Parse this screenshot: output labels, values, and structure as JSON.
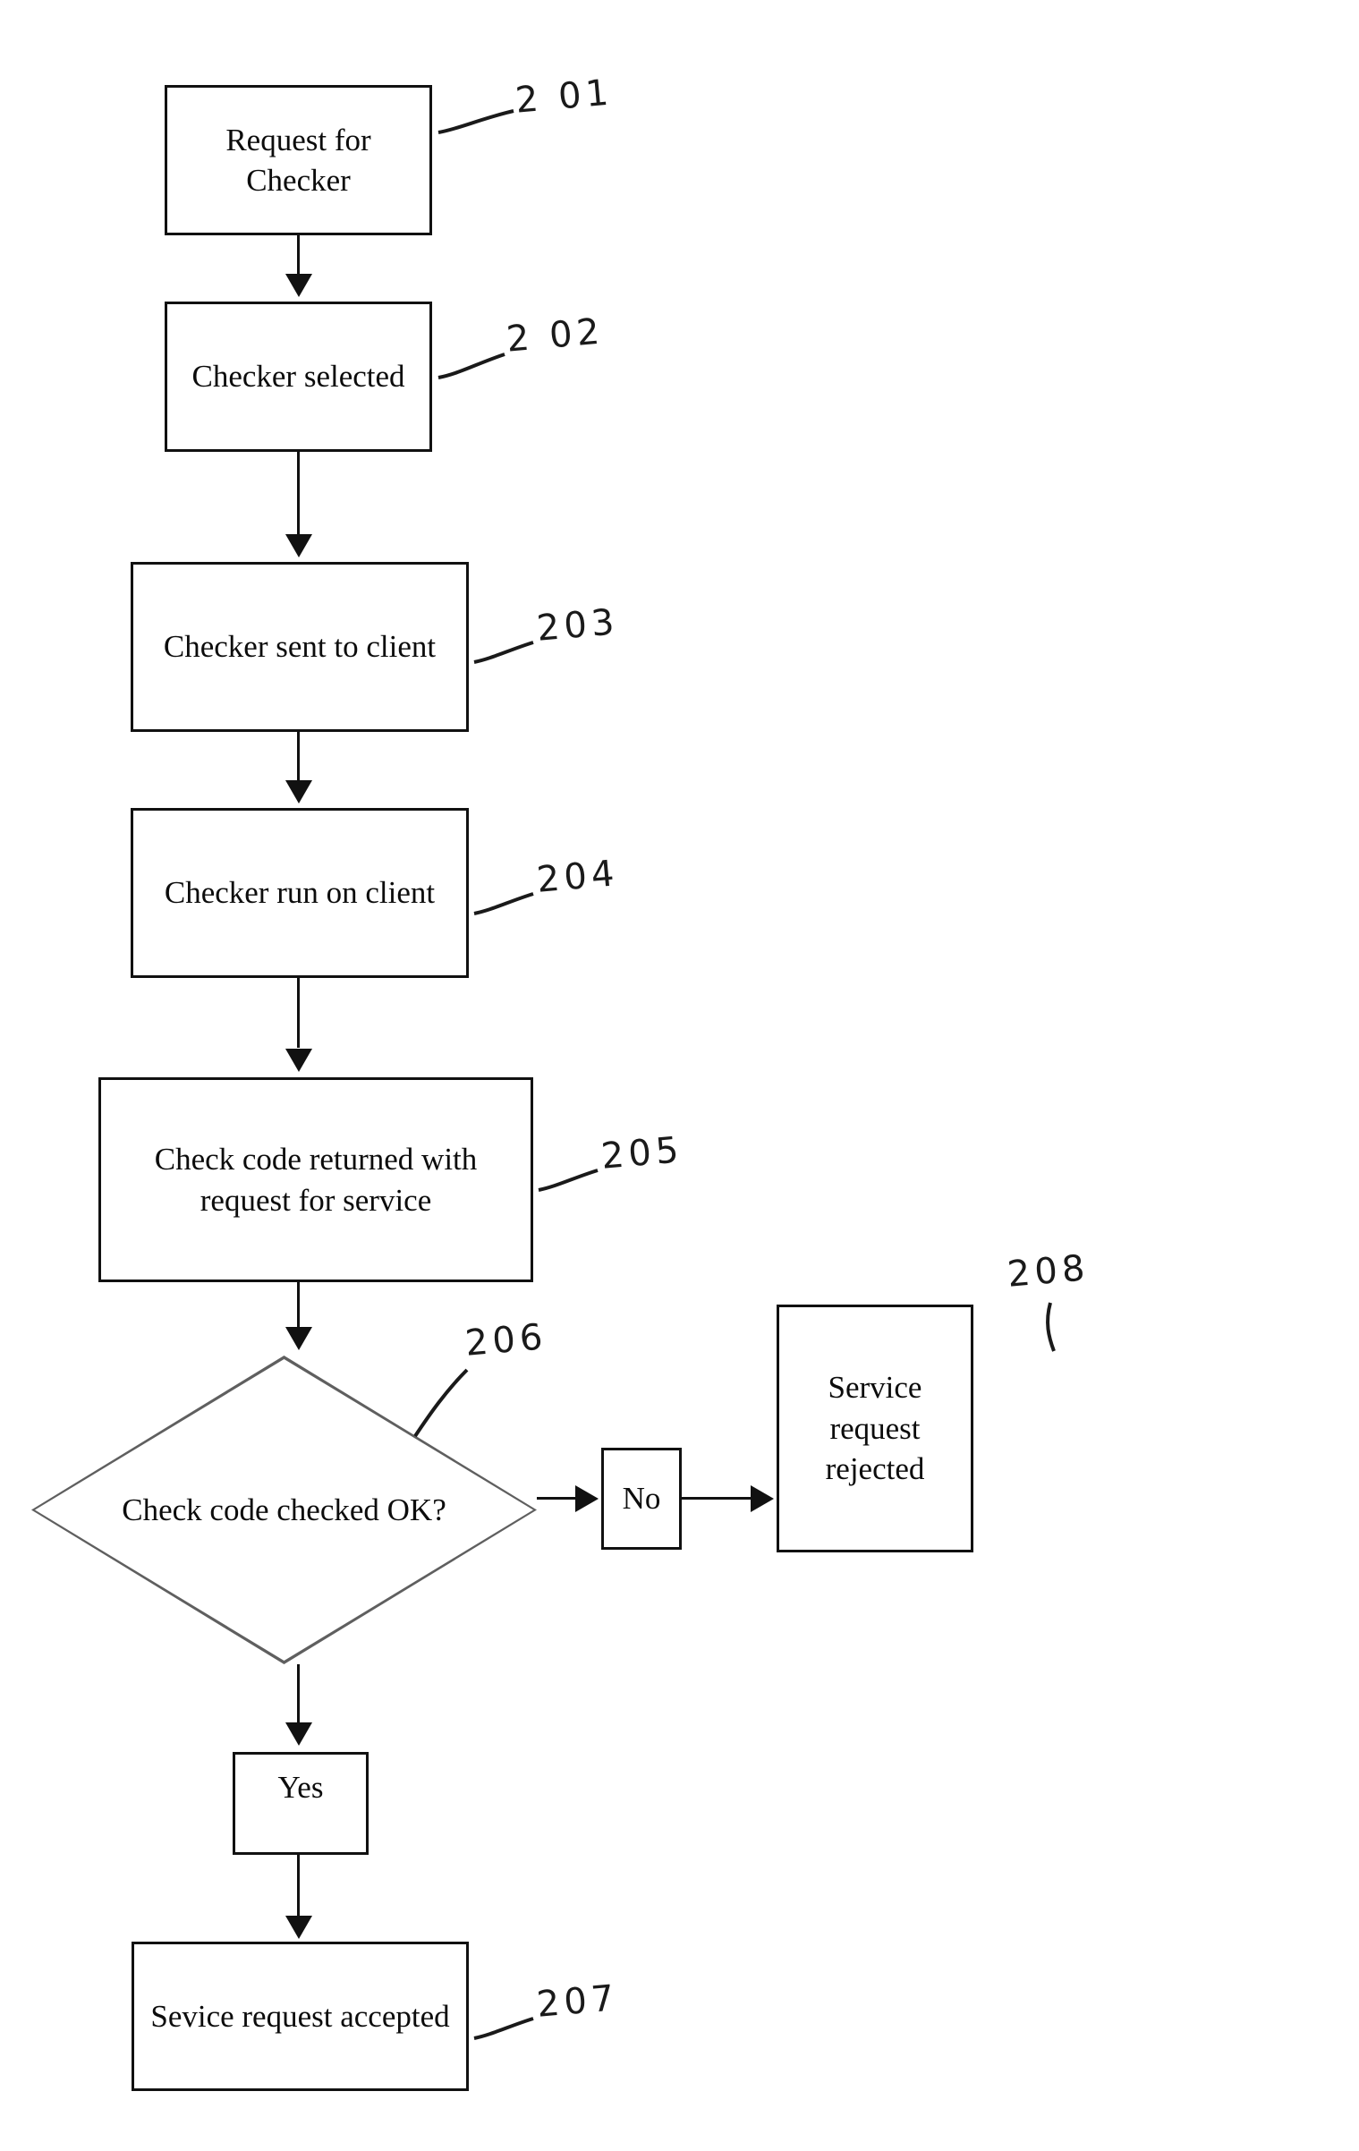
{
  "diagram": {
    "type": "flowchart",
    "title": "Checker request and verification flow",
    "nodes": [
      {
        "id": "201",
        "shape": "process",
        "text": "Request for Checker"
      },
      {
        "id": "202",
        "shape": "process",
        "text": "Checker selected"
      },
      {
        "id": "203",
        "shape": "process",
        "text": "Checker sent to client"
      },
      {
        "id": "204",
        "shape": "process",
        "text": "Checker run on client"
      },
      {
        "id": "205",
        "shape": "process",
        "text": "Check code returned with request for service"
      },
      {
        "id": "206",
        "shape": "decision",
        "text": "Check code checked OK?"
      },
      {
        "id": "no",
        "shape": "process",
        "text": "No"
      },
      {
        "id": "208",
        "shape": "process",
        "text": "Service request rejected"
      },
      {
        "id": "yes",
        "shape": "process",
        "text": "Yes"
      },
      {
        "id": "207",
        "shape": "process",
        "text": "Sevice request accepted"
      }
    ],
    "reference_numerals": [
      {
        "id": "ref-201",
        "value": "2 01"
      },
      {
        "id": "ref-202",
        "value": "2 02"
      },
      {
        "id": "ref-203",
        "value": "203"
      },
      {
        "id": "ref-204",
        "value": "204"
      },
      {
        "id": "ref-205",
        "value": "205"
      },
      {
        "id": "ref-206",
        "value": "206"
      },
      {
        "id": "ref-207",
        "value": "207"
      },
      {
        "id": "ref-208",
        "value": "208"
      }
    ],
    "edges": [
      {
        "from": "201",
        "to": "202",
        "label": ""
      },
      {
        "from": "202",
        "to": "203",
        "label": ""
      },
      {
        "from": "203",
        "to": "204",
        "label": ""
      },
      {
        "from": "204",
        "to": "205",
        "label": ""
      },
      {
        "from": "205",
        "to": "206",
        "label": ""
      },
      {
        "from": "206",
        "to": "no",
        "label": ""
      },
      {
        "from": "no",
        "to": "208",
        "label": ""
      },
      {
        "from": "206",
        "to": "yes",
        "label": ""
      },
      {
        "from": "yes",
        "to": "207",
        "label": ""
      }
    ],
    "colors": {
      "stroke": "#111111",
      "text": "#0c0c0c",
      "background": "#ffffff",
      "diamond_stroke": "#5f5f5f"
    }
  }
}
